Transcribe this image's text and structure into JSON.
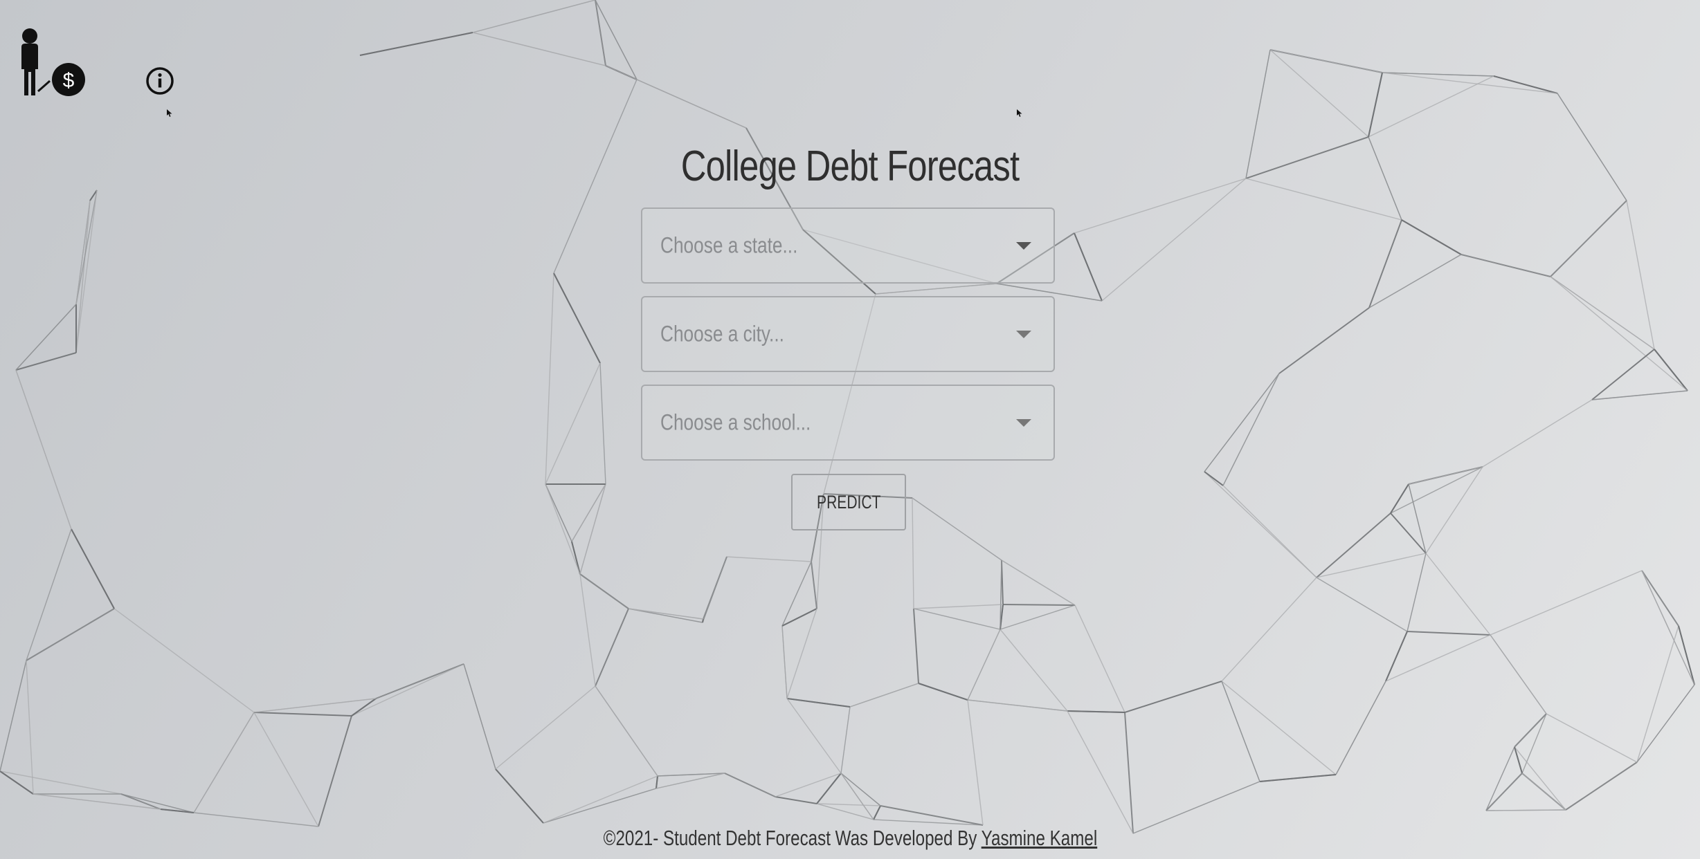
{
  "header": {
    "logo_icon": "student-debt-person-dollar-icon",
    "info_icon": "info-circle-icon"
  },
  "main": {
    "title": "College Debt Forecast",
    "state_select": {
      "placeholder": "Choose a state..."
    },
    "city_select": {
      "placeholder": "Choose a city..."
    },
    "school_select": {
      "placeholder": "Choose a school..."
    },
    "predict_label": "PREDICT"
  },
  "footer": {
    "text": "©2021- Student Debt Forecast Was Developed By ",
    "author_link": "Yasmine Kamel"
  },
  "colors": {
    "background_start": "#c4c7cb",
    "background_end": "#e4e5e6",
    "text": "#333333",
    "border": "#a8aaad",
    "placeholder": "#8a8c8f"
  }
}
